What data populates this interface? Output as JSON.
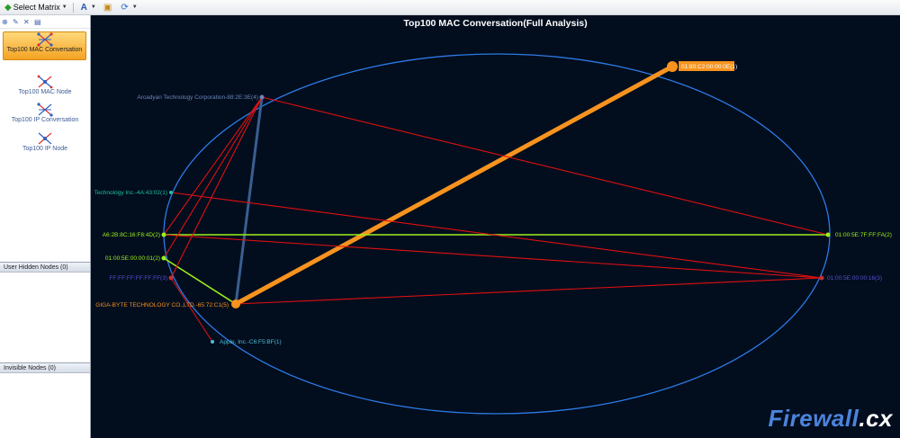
{
  "toolbar": {
    "select_matrix": "Select Matrix",
    "icons": [
      "matrix-icon",
      "font-icon",
      "export-icon",
      "refresh-icon"
    ]
  },
  "left_panel": {
    "tool_icons": [
      "add-icon",
      "edit-icon",
      "delete-icon",
      "properties-icon"
    ],
    "matrix_items": [
      {
        "label": "Top100 MAC Conversation",
        "selected": true
      },
      {
        "label": "Top100 MAC Node",
        "selected": false
      },
      {
        "label": "Top100 IP Conversation",
        "selected": false
      },
      {
        "label": "Top100 IP Node",
        "selected": false
      }
    ],
    "user_hidden_nodes": "User Hidden Nodes (0)",
    "invisible_nodes": "Invisible Nodes (0)"
  },
  "graph": {
    "title": "Top100 MAC Conversation(Full Analysis)",
    "colors": {
      "background": "#020d1e",
      "ellipse": "#2c7be5",
      "highlight": "#f7931e",
      "red_link": "#e01010",
      "green_link": "#9cf01a",
      "steel_link": "#3a5f8f"
    },
    "nodes": [
      {
        "id": "arcadyan",
        "label": "Arcadyan Technology Corporation-88:2E:3E(4)",
        "color": "#6b86b8"
      },
      {
        "id": "multicast-c2",
        "label": "01:80:C2:00:00:0E(1)",
        "color": "#ffffff"
      },
      {
        "id": "technology",
        "label": "Technology Inc.-4A:43:02(1)",
        "color": "#1fbfa0"
      },
      {
        "id": "a6",
        "label": "A6:2B:8C:16:F8:4D(2)",
        "color": "#9cf01a"
      },
      {
        "id": "mcast-fa",
        "label": "01:00:5E:7F:FF:FA(2)",
        "color": "#9cf01a"
      },
      {
        "id": "mcast-01",
        "label": "01:00:5E:00:00:01(2)",
        "color": "#9cf01a"
      },
      {
        "id": "broadcast",
        "label": "FF:FF:FF:FF:FF:FF(3)",
        "color": "#5a4fd0"
      },
      {
        "id": "mcast-16",
        "label": "01:00:5E:00:00:16(3)",
        "color": "#5a4fd0"
      },
      {
        "id": "gigabyte",
        "label": "GIGA-BYTE TECHNOLOGY CO.,LTD.-65:72:C1(5)",
        "color": "#f7931e"
      },
      {
        "id": "apple",
        "label": "Apple, Inc.-C6:F5:BF(1)",
        "color": "#4cc0d8"
      }
    ],
    "links": [
      {
        "from": "gigabyte",
        "to": "multicast-c2",
        "color": "highlight"
      },
      {
        "from": "gigabyte",
        "to": "arcadyan",
        "color": "steel_link"
      },
      {
        "from": "a6",
        "to": "mcast-fa",
        "color": "green_link"
      },
      {
        "from": "mcast-01",
        "to": "gigabyte",
        "color": "green_link"
      },
      {
        "from": "arcadyan",
        "to": "mcast-fa",
        "color": "red_link"
      },
      {
        "from": "arcadyan",
        "to": "a6",
        "color": "red_link"
      },
      {
        "from": "arcadyan",
        "to": "mcast-01",
        "color": "red_link"
      },
      {
        "from": "arcadyan",
        "to": "broadcast",
        "color": "red_link"
      },
      {
        "from": "technology",
        "to": "mcast-16",
        "color": "red_link"
      },
      {
        "from": "a6",
        "to": "mcast-16",
        "color": "red_link"
      },
      {
        "from": "gigabyte",
        "to": "mcast-16",
        "color": "red_link"
      },
      {
        "from": "broadcast",
        "to": "apple",
        "color": "red_link"
      }
    ]
  },
  "watermark": {
    "brand": "Firewall",
    "ext": ".cx"
  }
}
